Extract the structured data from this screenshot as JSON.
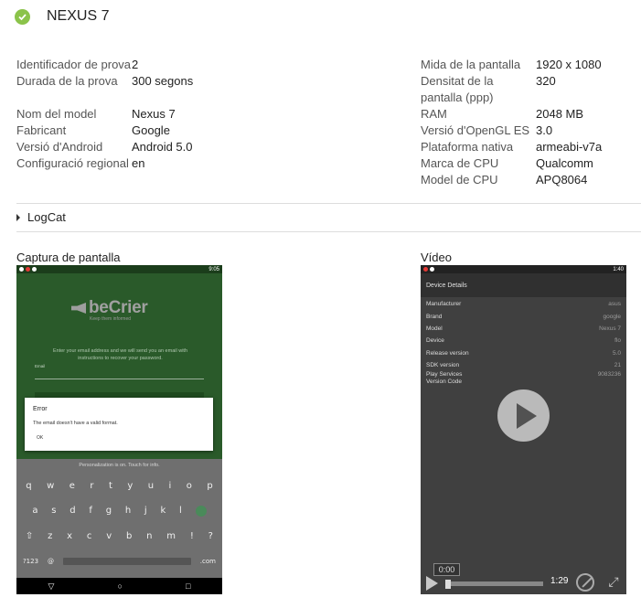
{
  "header": {
    "title": "NEXUS 7",
    "status": "passed"
  },
  "specs_left": [
    {
      "label": "Identificador de prova",
      "value": "2"
    },
    {
      "label": "Durada de la prova",
      "value": "300 segons"
    },
    {
      "label": "Nom del model",
      "value": "Nexus 7"
    },
    {
      "label": "Fabricant",
      "value": "Google"
    },
    {
      "label": "Versió d'Android",
      "value": "Android 5.0"
    },
    {
      "label": "Configuració regional",
      "value": "en"
    }
  ],
  "specs_right": [
    {
      "label": "Mida de la pantalla",
      "value": "1920 x 1080"
    },
    {
      "label": "Densitat de la pantalla (ppp)",
      "value": "320"
    },
    {
      "label": "RAM",
      "value": "2048 MB"
    },
    {
      "label": "Versió d'OpenGL ES",
      "value": "3.0"
    },
    {
      "label": "Plataforma nativa",
      "value": "armeabi-v7a"
    },
    {
      "label": "Marca de CPU",
      "value": "Qualcomm"
    },
    {
      "label": "Model de CPU",
      "value": "APQ8064"
    }
  ],
  "logcat": {
    "label": "LogCat"
  },
  "screenshot_section": {
    "label": "Captura de pantalla",
    "status_time": "9:05",
    "app_name": "beCrier",
    "tagline": "Keep them informed",
    "instructions": "Enter your email address and we will send you an email with instructions to recover your password.",
    "email_label": "Email",
    "dialog": {
      "title": "Error",
      "message": "The email doesn't have a valid format.",
      "ok": "OK"
    },
    "keyboard": {
      "note": "Personalization is on. Touch for info.",
      "row1": [
        "q",
        "w",
        "e",
        "r",
        "t",
        "y",
        "u",
        "i",
        "o",
        "p"
      ],
      "row2": [
        "a",
        "s",
        "d",
        "f",
        "g",
        "h",
        "j",
        "k",
        "l"
      ],
      "row3": [
        "⇧",
        "z",
        "x",
        "c",
        "v",
        "b",
        "n",
        "m",
        "!",
        "?"
      ],
      "symbols_key": "?123",
      "at_key": "@",
      "com_key": ".com"
    },
    "nav": {
      "back": "▽",
      "home": "○",
      "recents": "□"
    }
  },
  "video_section": {
    "label": "Vídeo",
    "status_time": "1:40",
    "toolbar_title": "Device Details",
    "details": [
      {
        "key": "Manufacturer",
        "value": "asus"
      },
      {
        "key": "Brand",
        "value": "google"
      },
      {
        "key": "Model",
        "value": "Nexus 7"
      },
      {
        "key": "Device",
        "value": "flo"
      },
      {
        "key": "Release version",
        "value": "5.0"
      },
      {
        "key": "SDK version",
        "value": "21"
      },
      {
        "key": "Play Services Version Code",
        "value": "9083236"
      }
    ],
    "current_time": "0:00",
    "duration": "1:29"
  }
}
